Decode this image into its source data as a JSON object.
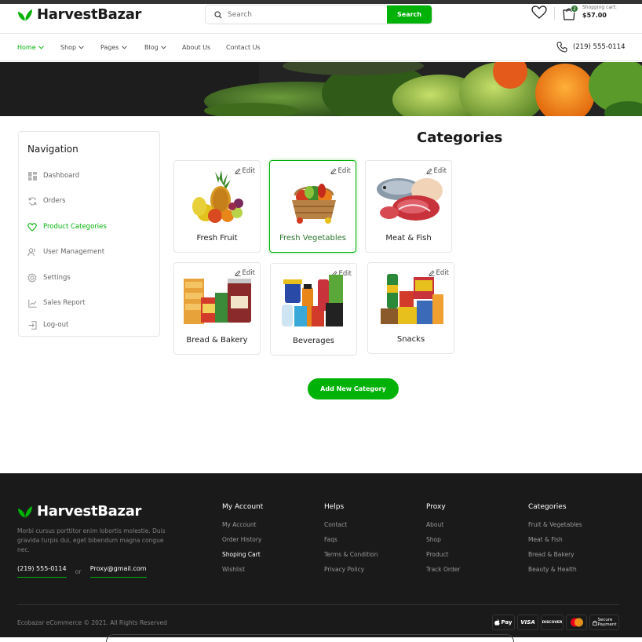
{
  "brand": {
    "name": "HarvestBazar",
    "accent": "#00b207",
    "dark_green": "#2c742f"
  },
  "search": {
    "placeholder": "Search",
    "button_label": "Search"
  },
  "cart": {
    "label": "Shopping cart:",
    "total": "$57.00",
    "count": "2"
  },
  "nav": {
    "items": [
      {
        "label": "Home",
        "dropdown": true,
        "active": true
      },
      {
        "label": "Shop",
        "dropdown": true
      },
      {
        "label": "Pages",
        "dropdown": true
      },
      {
        "label": "Blog",
        "dropdown": true
      },
      {
        "label": "About Us",
        "dropdown": false
      },
      {
        "label": "Contact Us",
        "dropdown": false
      }
    ],
    "phone": "(219) 555-0114"
  },
  "sidebar": {
    "title": "Navigation",
    "items": [
      {
        "label": "Dashboard",
        "icon": "grid-icon"
      },
      {
        "label": "Orders",
        "icon": "refresh-icon"
      },
      {
        "label": "Product Categories",
        "icon": "heart-icon",
        "active": true
      },
      {
        "label": "User Management",
        "icon": "users-icon"
      },
      {
        "label": "Settings",
        "icon": "gear-icon"
      },
      {
        "label": "Sales Report",
        "icon": "chart-icon"
      },
      {
        "label": "Log-out",
        "icon": "logout-icon"
      }
    ]
  },
  "main": {
    "title": "Categories",
    "edit_label": "Edit",
    "categories": [
      {
        "label": "Fresh Fruit"
      },
      {
        "label": "Fresh Vegetables",
        "active": true
      },
      {
        "label": "Meat & Fish"
      },
      {
        "label": "Bread & Bakery"
      },
      {
        "label": "Beverages"
      },
      {
        "label": "Snacks"
      }
    ],
    "add_button": "Add New Category"
  },
  "footer": {
    "brand": "HarvestBazar",
    "description": "Morbi cursus porttitor enim lobortis molestie. Duis gravida turpis dui, eget bibendum magna congue nec.",
    "phone": "(219) 555-0114",
    "or": "or",
    "email": "Proxy@gmail.com",
    "columns": [
      {
        "title": "My Account",
        "links": [
          "My Account",
          "Order History",
          "Shoping Cart",
          "Wishlist"
        ],
        "highlight": 2
      },
      {
        "title": "Helps",
        "links": [
          "Contact",
          "Faqs",
          "Terms & Condition",
          "Privacy Policy"
        ]
      },
      {
        "title": "Proxy",
        "links": [
          "About",
          "Shop",
          "Product",
          "Track Order"
        ]
      },
      {
        "title": "Categories",
        "links": [
          "Fruit & Vegetables",
          "Meat & Fish",
          "Bread & Bakery",
          "Beauty & Health"
        ]
      }
    ],
    "copyright": "Ecobazar eCommerce © 2021. All Rights Reserved",
    "payments": [
      "Pay",
      "VISA",
      "DISCOVER",
      "mastercard",
      "Secure Payment"
    ]
  }
}
